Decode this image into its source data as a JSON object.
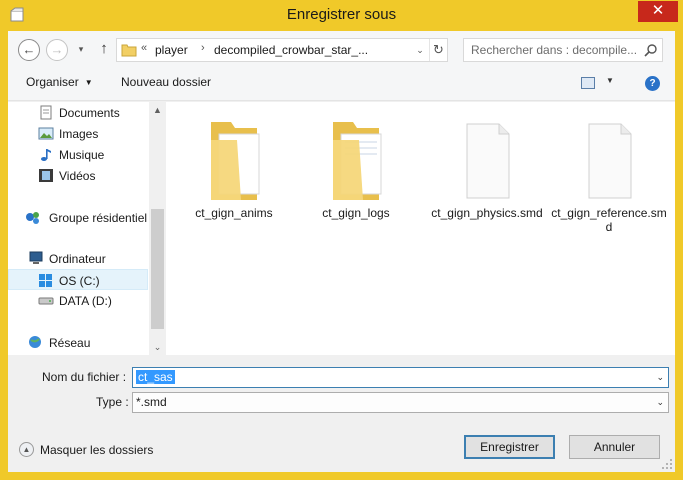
{
  "window": {
    "title": "Enregistrer sous",
    "close_glyph": "✕"
  },
  "address": {
    "back_glyph": "←",
    "forward_glyph": "→",
    "recent_glyph": "▾",
    "up_glyph": "↑",
    "overflow": "«",
    "crumbs": [
      "player",
      "decompiled_crowbar_star_..."
    ],
    "chevron": "›",
    "dropdown_glyph": "⌄",
    "refresh_glyph": "↻"
  },
  "search": {
    "placeholder": "Rechercher dans : decompile..."
  },
  "toolbar": {
    "organise_label": "Organiser",
    "organise_caret": "▼",
    "new_folder_label": "Nouveau dossier",
    "view_caret": "▼",
    "help_glyph": "?"
  },
  "nav": {
    "items": [
      {
        "label": "Documents",
        "icon": "documents-icon"
      },
      {
        "label": "Images",
        "icon": "images-icon"
      },
      {
        "label": "Musique",
        "icon": "music-icon"
      },
      {
        "label": "Vidéos",
        "icon": "videos-icon"
      },
      {
        "label": "Groupe résidentiel",
        "icon": "homegroup-icon"
      },
      {
        "label": "Ordinateur",
        "icon": "computer-icon"
      },
      {
        "label": "OS (C:)",
        "icon": "drive-c-icon",
        "selected": true
      },
      {
        "label": "DATA (D:)",
        "icon": "drive-d-icon"
      },
      {
        "label": "Réseau",
        "icon": "network-icon"
      }
    ],
    "scroll_up": "▲",
    "scroll_down": "⌄"
  },
  "files": [
    {
      "name": "ct_gign_anims",
      "kind": "folder"
    },
    {
      "name": "ct_gign_logs",
      "kind": "folder"
    },
    {
      "name": "ct_gign_physics.smd",
      "kind": "file"
    },
    {
      "name": "ct_gign_reference.smd",
      "kind": "file"
    }
  ],
  "form": {
    "filename_label": "Nom du fichier :",
    "filename_value": "ct_sas",
    "type_label": "Type :",
    "type_value": "*.smd",
    "dropdown_glyph": "⌄",
    "hide_folders_label": "Masquer les dossiers",
    "hide_folders_glyph": "▲",
    "save_label": "Enregistrer",
    "cancel_label": "Annuler"
  },
  "colors": {
    "title_bar": "#f0c929",
    "close_button": "#c7281b",
    "selection": "#3399ff",
    "folder": "#f2d16b"
  }
}
